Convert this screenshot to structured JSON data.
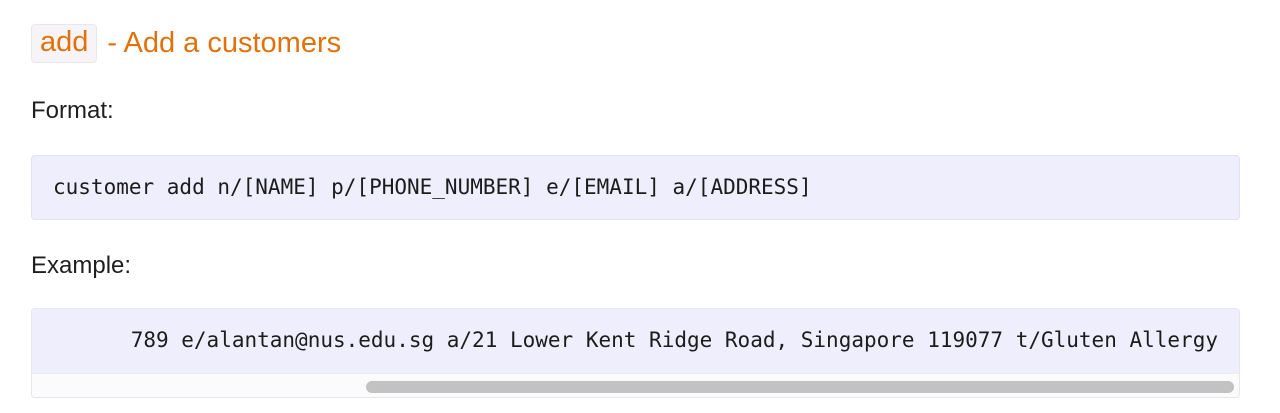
{
  "section": {
    "command_code": "add",
    "title": "- Add a customers"
  },
  "format": {
    "label": "Format:",
    "code": "customer add n/[NAME] p/[PHONE_NUMBER] e/[EMAIL] a/[ADDRESS]"
  },
  "example": {
    "label": "Example:",
    "code_visible": "789 e/alantan@nus.edu.sg a/21 Lower Kent Ridge Road, Singapore 119077 t/Gluten Allergy",
    "scroll_position": 1.0
  },
  "colors": {
    "heading": "#e1720b",
    "code_background": "#efeefc",
    "scrollbar_thumb": "#c2c2c2"
  }
}
